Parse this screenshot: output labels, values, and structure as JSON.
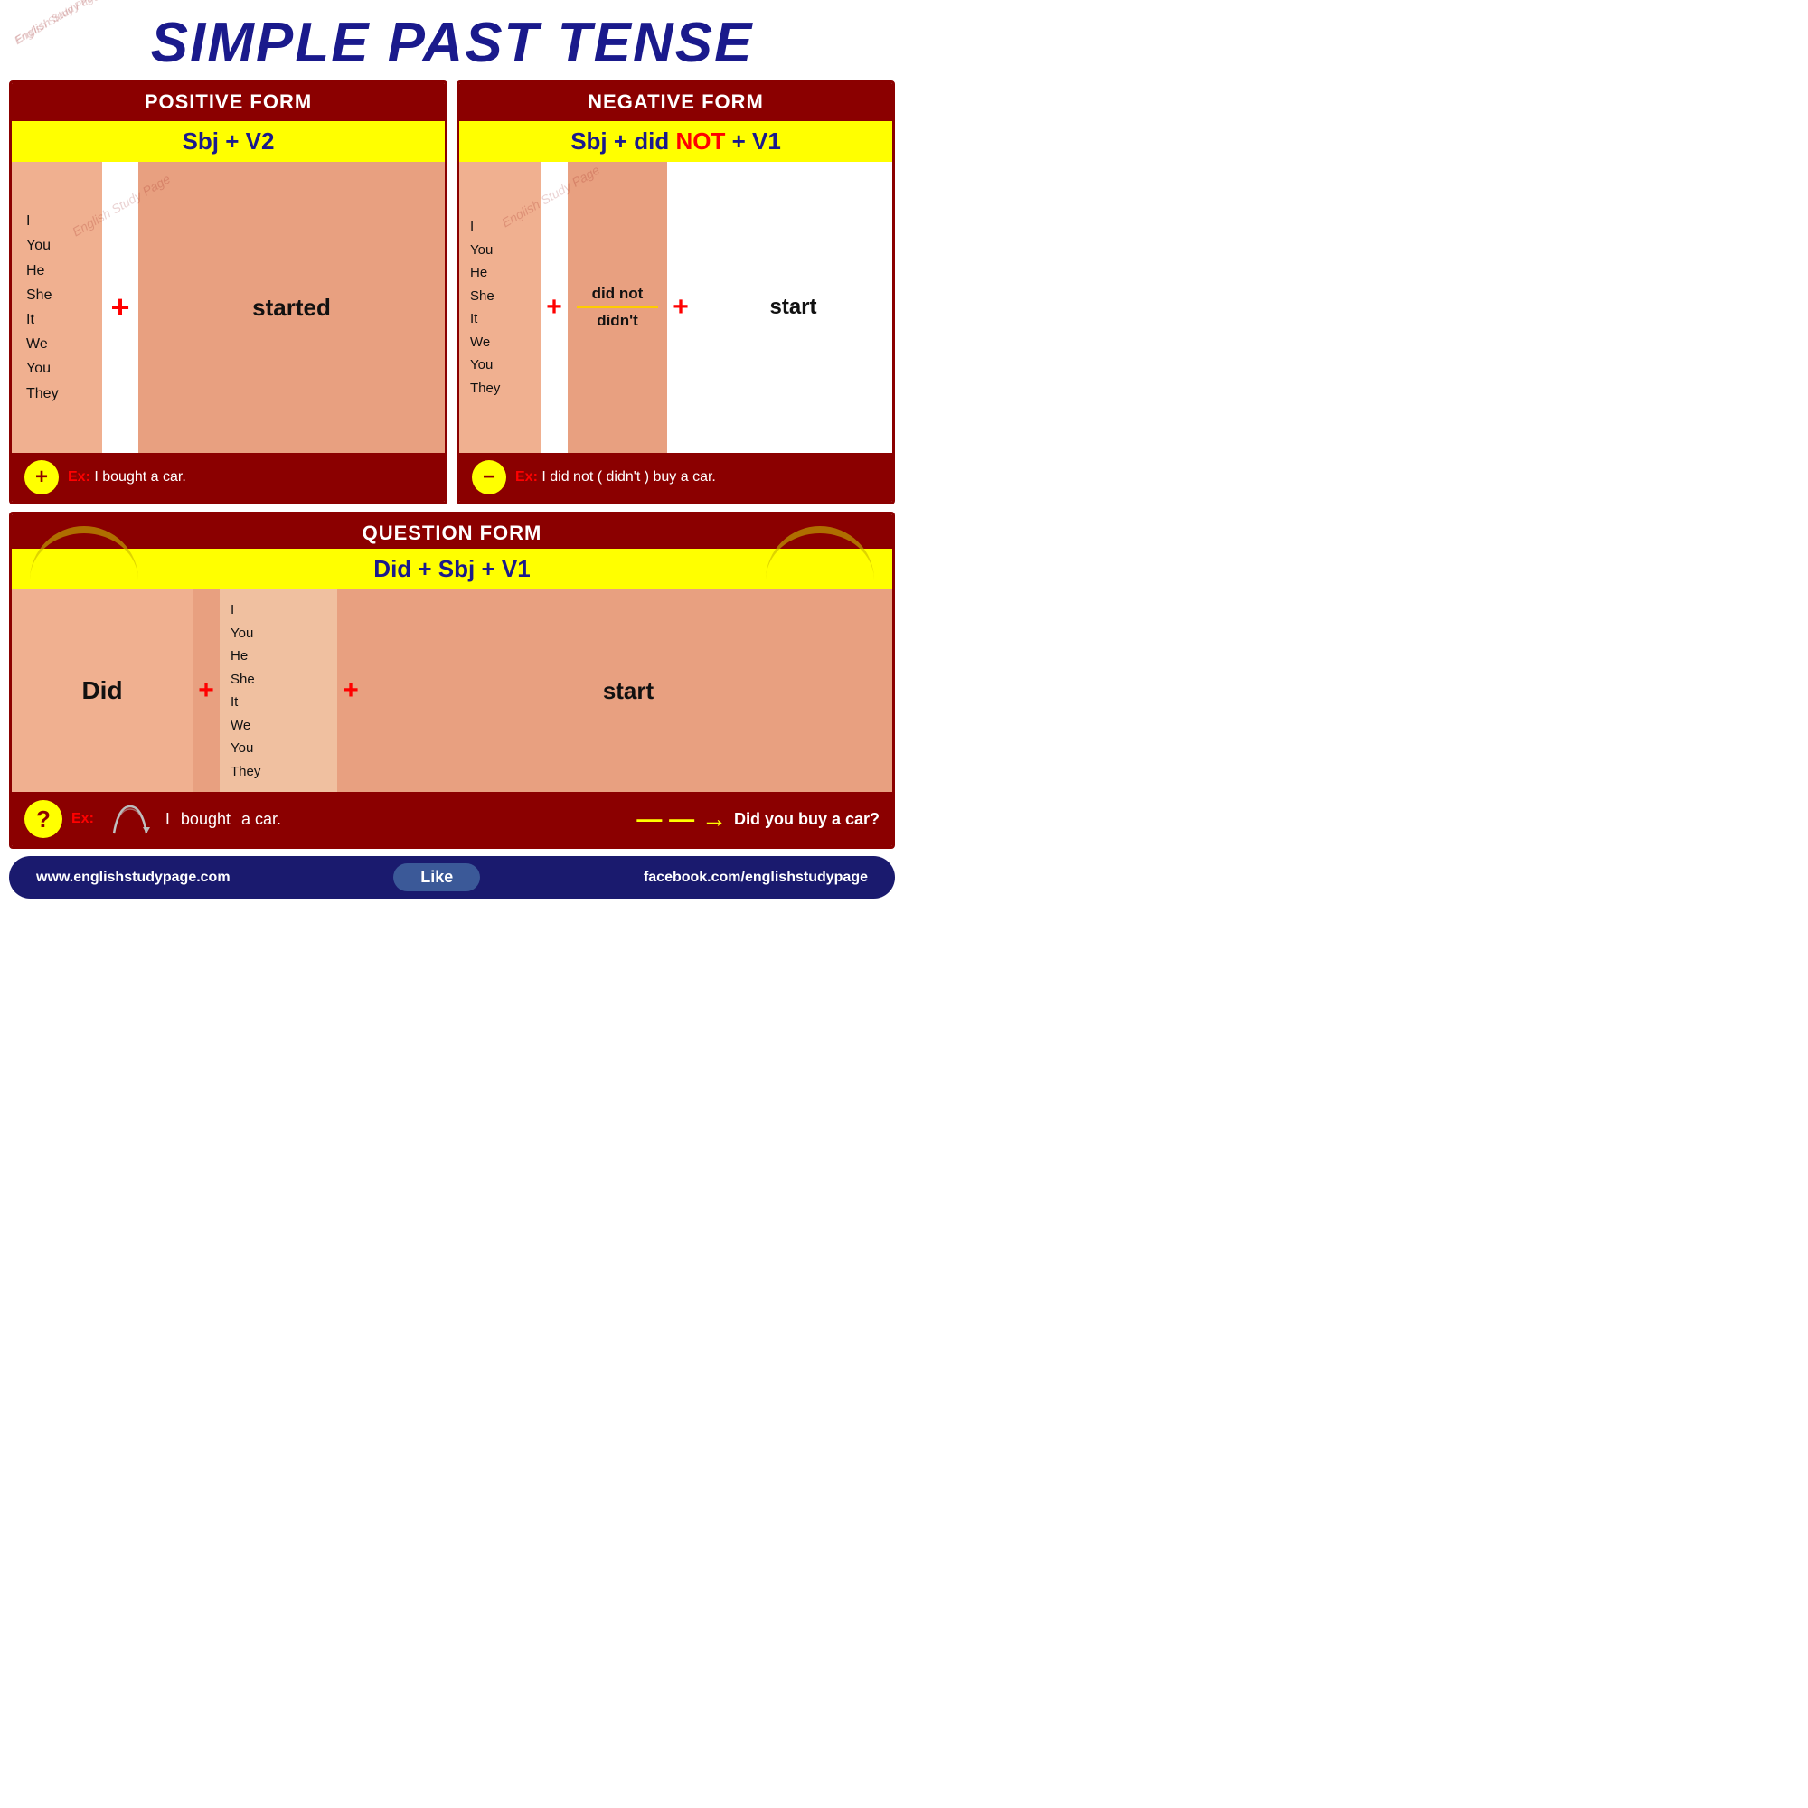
{
  "title": "SIMPLE PAST TENSE",
  "positive": {
    "header": "POSITIVE FORM",
    "formula": "Sbj + V2",
    "subjects": [
      "I",
      "You",
      "He",
      "She",
      "It",
      "We",
      "You",
      "They"
    ],
    "plus": "+",
    "verb": "started",
    "example_label": "Ex:",
    "example_text": "I bought a car.",
    "circle_symbol": "+"
  },
  "negative": {
    "header": "NEGATIVE FORM",
    "formula_prefix": "Sbj + did ",
    "formula_not": "NOT",
    "formula_suffix": " + V1",
    "subjects": [
      "I",
      "You",
      "He",
      "She",
      "It",
      "We",
      "You",
      "They"
    ],
    "plus": "+",
    "did_not": "did not",
    "didnt": "didn't",
    "plus2": "+",
    "verb": "start",
    "example_label": "Ex:",
    "example_text": "I did not ( didn't ) buy a car.",
    "circle_symbol": "−"
  },
  "question": {
    "header": "QUESTION FORM",
    "formula": "Did +  Sbj + V1",
    "did": "Did",
    "subjects": [
      "I",
      "You",
      "He",
      "She",
      "It",
      "We",
      "You",
      "They"
    ],
    "plus": "+",
    "plus2": "+",
    "verb": "start",
    "example_label": "Ex:",
    "example_sentence_prefix": "I",
    "example_sentence_verb": "bought",
    "example_sentence_suffix": "a car.",
    "circle_symbol": "?",
    "arrow": "— — →",
    "result": "Did you buy a car?"
  },
  "footer": {
    "left": "www.englishstudypage.com",
    "like": "Like",
    "right": "facebook.com/englishstudypage"
  },
  "watermark": "English Study Page"
}
